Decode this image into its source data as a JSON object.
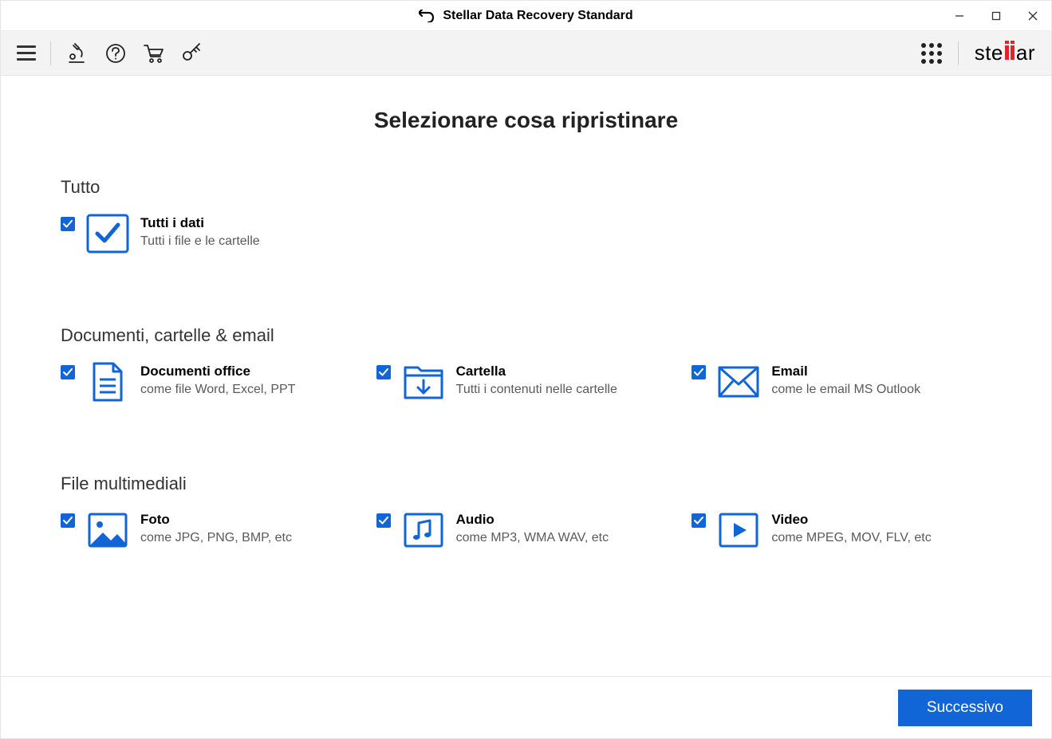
{
  "app_title": "Stellar Data Recovery Standard",
  "page_title": "Selezionare cosa ripristinare",
  "sections": {
    "everything": {
      "title": "Tutto",
      "option": {
        "title": "Tutti i dati",
        "subtitle": "Tutti i file e le cartelle",
        "checked": true
      }
    },
    "docs": {
      "title": "Documenti, cartelle & email",
      "options": [
        {
          "title": "Documenti office",
          "subtitle": "come file Word, Excel, PPT",
          "checked": true
        },
        {
          "title": "Cartella",
          "subtitle": "Tutti i contenuti nelle cartelle",
          "checked": true
        },
        {
          "title": "Email",
          "subtitle": "come le email MS Outlook",
          "checked": true
        }
      ]
    },
    "media": {
      "title": "File multimediali",
      "options": [
        {
          "title": "Foto",
          "subtitle": "come JPG, PNG, BMP, etc",
          "checked": true
        },
        {
          "title": "Audio",
          "subtitle": "come MP3, WMA WAV, etc",
          "checked": true
        },
        {
          "title": "Video",
          "subtitle": "come MPEG, MOV, FLV, etc",
          "checked": true
        }
      ]
    }
  },
  "footer": {
    "next_label": "Successivo"
  },
  "logo_text": {
    "pre": "ste",
    "post": "ar"
  }
}
